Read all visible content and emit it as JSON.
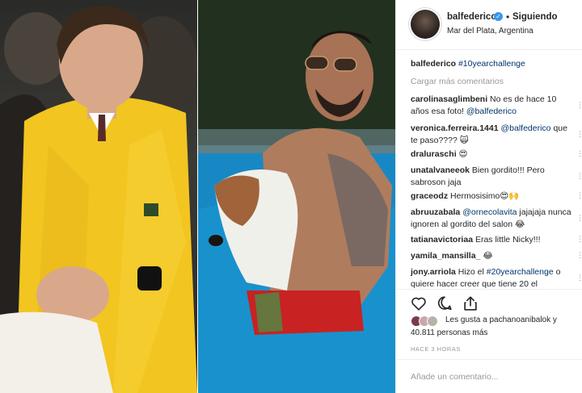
{
  "post": {
    "username": "balfederico",
    "verified_mark": "✓",
    "separator": "•",
    "follow_label": "Siguiendo",
    "location": "Mar del Plata, Argentina"
  },
  "comments_section": {
    "load_more": "Cargar más comentarios",
    "caption": {
      "user": "balfederico",
      "text": "#10yearchallenge"
    },
    "items": [
      {
        "user": "carolinasaglimbeni",
        "text_before": "No es de hace 10 años esa foto! ",
        "mention": "@balfederico",
        "text_after": ""
      },
      {
        "user": "veronica.ferreira.1441",
        "text_before": "",
        "mention": "@balfederico",
        "text_after": " que te paso???? 🙀"
      },
      {
        "user": "draluraschi",
        "text_before": "😍",
        "mention": "",
        "text_after": ""
      },
      {
        "user": "unatalvaneeok",
        "text_before": "Bien gordito!!! Pero sabroson jaja",
        "mention": "",
        "text_after": ""
      },
      {
        "user": "graceodz",
        "text_before": "Hermosisimo😍🙌",
        "mention": "",
        "text_after": ""
      },
      {
        "user": "abruuzabala",
        "text_before": "",
        "mention": "@ornecolavita",
        "text_after": " jajajaja nunca ignoren al gordito del salon 😂"
      },
      {
        "user": "tatianavictoriaa",
        "text_before": "Eras little Nicky!!!",
        "mention": "",
        "text_after": ""
      },
      {
        "user": "yamila_mansilla_",
        "text_before": "😂",
        "mention": "",
        "text_after": ""
      },
      {
        "user": "jony.arriola",
        "text_before": "Hizo el ",
        "mention": "#20yearchallenge",
        "text_after": " o quiere hacer creer que tiene 20 el"
      }
    ]
  },
  "actions": {
    "like_icon": "heart-icon",
    "comment_icon": "comment-icon",
    "share_icon": "share-icon"
  },
  "likes": {
    "line1": "Les gusta a pachanoanibalok y",
    "line2": "40.811 personas más"
  },
  "timestamp": "HACE 3 HORAS",
  "add_comment": {
    "placeholder": "Añade un comentario..."
  },
  "colors": {
    "link": "#003569",
    "verified": "#3897f0",
    "muted": "#999999"
  }
}
